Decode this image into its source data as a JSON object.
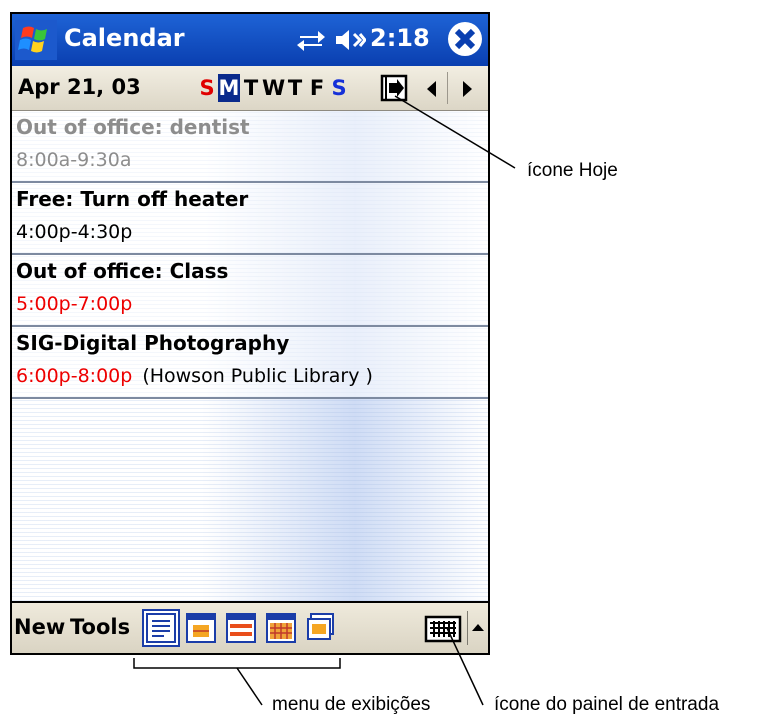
{
  "titlebar": {
    "app_title": "Calendar",
    "clock": "2:18",
    "icons": [
      "windows-start-icon",
      "connectivity-icon",
      "speaker-icon",
      "close-icon"
    ],
    "color": "#0a3fb0"
  },
  "datebar": {
    "date": "Apr 21, 03",
    "days": [
      "S",
      "M",
      "T",
      "W",
      "T",
      "F",
      "S"
    ],
    "selected_day": "M",
    "icons": [
      "today-icon",
      "arrow-left-icon",
      "arrow-right-icon"
    ]
  },
  "appointments": [
    {
      "title": "Out of office: dentist",
      "time": "8:00a-9:30a",
      "location": "",
      "style": "past"
    },
    {
      "title": "Free: Turn off heater",
      "time": "4:00p-4:30p",
      "location": "",
      "style": "normal"
    },
    {
      "title": "Out of office: Class",
      "time": "5:00p-7:00p",
      "location": "",
      "style": "conflict"
    },
    {
      "title": "SIG-Digital Photography",
      "time": "6:00p-8:00p",
      "location": "(Howson Public Library )",
      "style": "conflict"
    }
  ],
  "menubar": {
    "new_label": "New",
    "tools_label": "Tools",
    "views": [
      "agenda-view-icon",
      "day-view-icon",
      "week-view-icon",
      "month-view-icon",
      "year-view-icon"
    ],
    "icons": [
      "keyboard-icon",
      "sip-arrow-icon"
    ]
  },
  "callouts": {
    "today_icon": "ícone Hoje",
    "views_menu": "menu de exibições",
    "input_panel_icon": "ícone do painel de entrada"
  },
  "colors": {
    "title_bar": "#0a3fb0",
    "sunday": "#e00000",
    "saturday": "#1530d8",
    "selected_day_bg": "#0a2a8c",
    "conflict_time": "#ee0000",
    "past_text": "#8d8d8d"
  }
}
